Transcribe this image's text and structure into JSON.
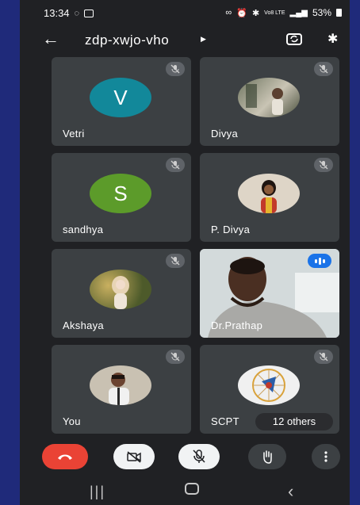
{
  "status": {
    "time": "13:34",
    "battery": "53%",
    "network": "Vo8 LTE"
  },
  "header": {
    "meeting_code": "zdp-xwjo-vho"
  },
  "participants": [
    {
      "name": "Vetri",
      "initial": "V",
      "avatar_color": "#12889a",
      "muted": true
    },
    {
      "name": "Divya",
      "initial": "",
      "avatar_color": "#8a8f7a",
      "muted": true
    },
    {
      "name": "sandhya",
      "initial": "S",
      "avatar_color": "#5c9b2a",
      "muted": true
    },
    {
      "name": "P. Divya",
      "initial": "",
      "avatar_color": "#d9c9b8",
      "muted": true
    },
    {
      "name": "Akshaya",
      "initial": "",
      "avatar_color": "#6d6a3a",
      "muted": true
    },
    {
      "name": "Dr.Prathap",
      "initial": "",
      "avatar_color": "#cfd6d8",
      "muted": false,
      "speaking": true
    },
    {
      "name": "You",
      "initial": "",
      "avatar_color": "#b9b0a2",
      "muted": true
    },
    {
      "name": "SCPT",
      "initial": "",
      "avatar_color": "#e8e8e8",
      "muted": true
    }
  ],
  "others_label": "12 others",
  "colors": {
    "accent": "#1a73e8",
    "end_call": "#ea4335",
    "tile_bg": "#3c4043",
    "background": "#202124"
  },
  "icons": {
    "back": "arrow-left-icon",
    "switch_camera": "switch-camera-icon",
    "bluetooth": "bluetooth-icon",
    "end_call": "end-call-icon",
    "camera_off": "camera-off-icon",
    "mic_off": "mic-off-icon",
    "raise_hand": "raise-hand-icon",
    "more": "more-vert-icon"
  }
}
